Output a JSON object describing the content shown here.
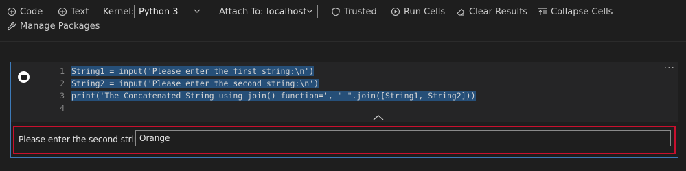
{
  "toolbar": {
    "code_label": "Code",
    "text_label": "Text",
    "kernel_label": "Kernel:",
    "kernel_value": "Python 3",
    "attach_label": "Attach To:",
    "attach_value": "localhost",
    "trusted_label": "Trusted",
    "run_cells_label": "Run Cells",
    "clear_results_label": "Clear Results",
    "collapse_cells_label": "Collapse Cells",
    "manage_packages_label": "Manage Packages"
  },
  "cell": {
    "lines": [
      {
        "num": "1",
        "text": "String1 = input('Please enter the first string:\\n')"
      },
      {
        "num": "2",
        "text": "String2 = input('Please enter the second string:\\n')"
      },
      {
        "num": "3",
        "text": "print('The Concatenated String using join() function=', \" \".join([String1, String2]))"
      },
      {
        "num": "4",
        "text": ""
      }
    ],
    "more_label": "···"
  },
  "output": {
    "prompt_label": "Please enter the second string:",
    "input_value": "Orange"
  },
  "colors": {
    "accent": "#3d7ab8",
    "output_border": "#c8102e",
    "selection": "#264f78",
    "string": "#ce9178"
  }
}
